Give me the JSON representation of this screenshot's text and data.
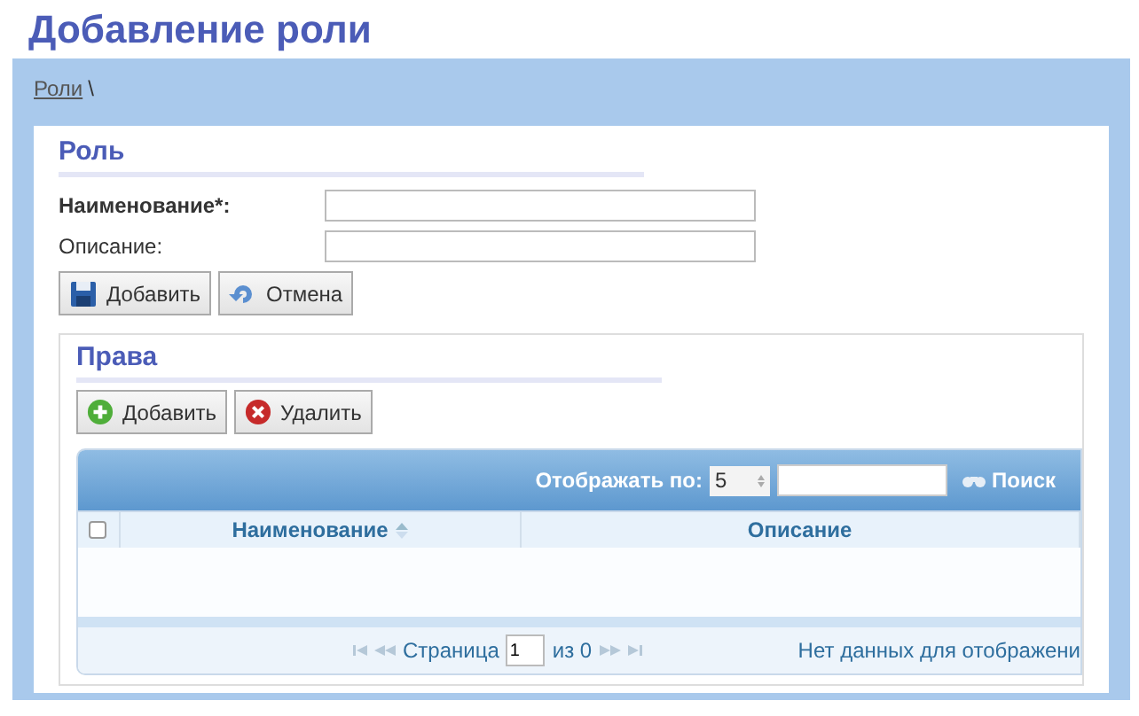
{
  "page_title": "Добавление роли",
  "breadcrumb": {
    "link": "Роли",
    "separator": "\\"
  },
  "role_section": {
    "title": "Роль",
    "fields": [
      {
        "label": "Наименование*:",
        "required": true
      },
      {
        "label": "Описание:",
        "required": false
      }
    ],
    "buttons": [
      {
        "label": "Добавить",
        "kind": "save"
      },
      {
        "label": "Отмена",
        "kind": "cancel"
      }
    ]
  },
  "rights_section": {
    "title": "Права",
    "buttons": [
      {
        "label": "Добавить",
        "kind": "add"
      },
      {
        "label": "Удалить",
        "kind": "delete"
      }
    ],
    "grid": {
      "page_size_label": "Отображать по:",
      "page_size": "5",
      "search_label": "Поиск",
      "select_all_checked": false,
      "columns": [
        {
          "label": "Наименование",
          "sorted": true
        },
        {
          "label": "Описание",
          "sorted": false
        }
      ],
      "pager": {
        "page_label": "Страница",
        "page": "1",
        "of_label": "из 0",
        "status": "Нет данных для отображени"
      }
    }
  }
}
